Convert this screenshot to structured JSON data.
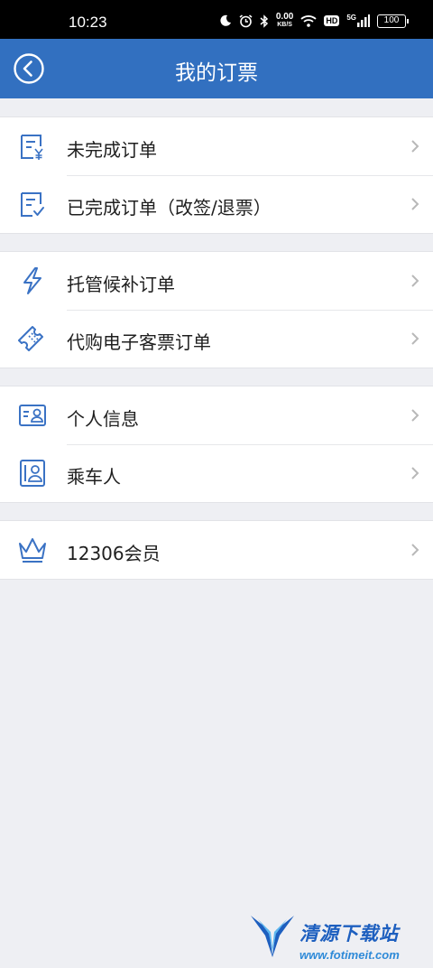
{
  "status_bar": {
    "time": "10:23",
    "net_speed_value": "0.00",
    "net_speed_unit": "KB/S",
    "hd_badge": "HD",
    "signal_badge": "5G",
    "battery": "100"
  },
  "header": {
    "title": "我的订票",
    "background_color": "#3270c0"
  },
  "menu_groups": [
    {
      "items": [
        {
          "label": "未完成订单",
          "icon": "pending-order-icon"
        },
        {
          "label": "已完成订单（改签/退票）",
          "icon": "completed-order-icon"
        }
      ]
    },
    {
      "items": [
        {
          "label": "托管候补订单",
          "icon": "lightning-icon"
        },
        {
          "label": "代购电子客票订单",
          "icon": "ticket-icon"
        }
      ]
    },
    {
      "items": [
        {
          "label": "个人信息",
          "icon": "id-card-icon"
        },
        {
          "label": "乘车人",
          "icon": "passenger-icon"
        }
      ]
    },
    {
      "items": [
        {
          "label": "12306会员",
          "icon": "crown-icon"
        }
      ]
    }
  ],
  "watermark": {
    "title": "清源下载站",
    "url": "www.fotimeit.com"
  },
  "colors": {
    "accent": "#3270c0",
    "icon": "#3a72c4",
    "chevron": "#b8b8b8",
    "page_background": "#eeeff3"
  }
}
